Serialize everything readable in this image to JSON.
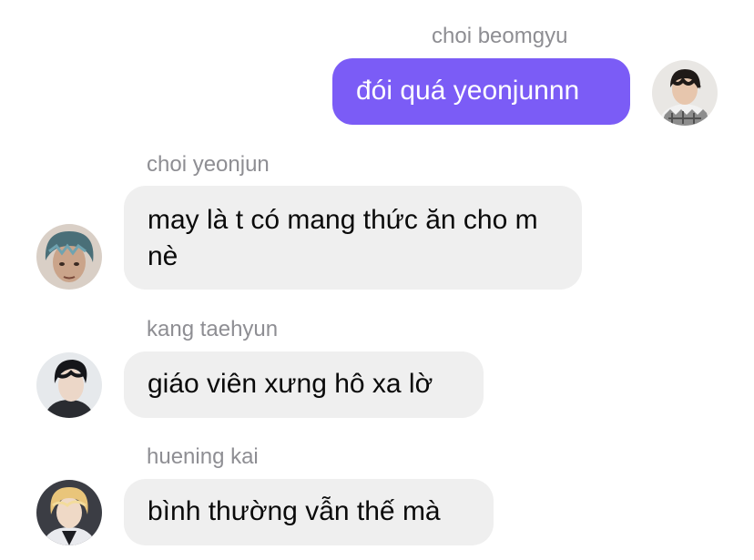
{
  "colors": {
    "outgoing_bubble": "#7b5cf6",
    "incoming_bubble": "#efefef",
    "sender_name": "#8e8e93"
  },
  "messages": [
    {
      "sender": "choi beomgyu",
      "text": "đói quá yeonjunnn",
      "direction": "outgoing",
      "avatar_icon": "beomgyu-avatar"
    },
    {
      "sender": "choi yeonjun",
      "text": "may là t có mang thức ăn cho m nè",
      "direction": "incoming",
      "avatar_icon": "yeonjun-avatar"
    },
    {
      "sender": "kang taehyun",
      "text": "giáo viên xưng hô xa lờ",
      "direction": "incoming",
      "avatar_icon": "taehyun-avatar"
    },
    {
      "sender": "huening kai",
      "text": "bình thường vẫn thế mà",
      "direction": "incoming",
      "avatar_icon": "hueningkai-avatar"
    }
  ]
}
